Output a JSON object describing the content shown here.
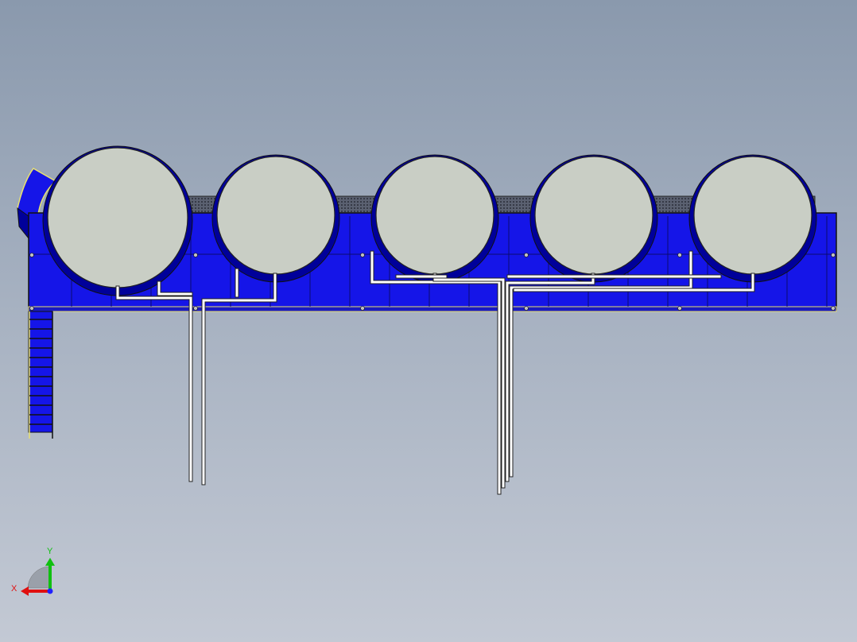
{
  "view": {
    "background_top": "#8a99ad",
    "background_bottom": "#c3c9d4"
  },
  "model": {
    "hull_color": "#1515e8",
    "hull_dark": "#00009a",
    "tank_fill": "#c9cec5",
    "pipe_color": "#ffffff",
    "rail_color": "#e8e070",
    "tank_count": 5
  },
  "triad": {
    "x_label": "X",
    "y_label": "Y",
    "x_color": "#e01010",
    "y_color": "#10c010",
    "z_color": "#2020ff"
  }
}
